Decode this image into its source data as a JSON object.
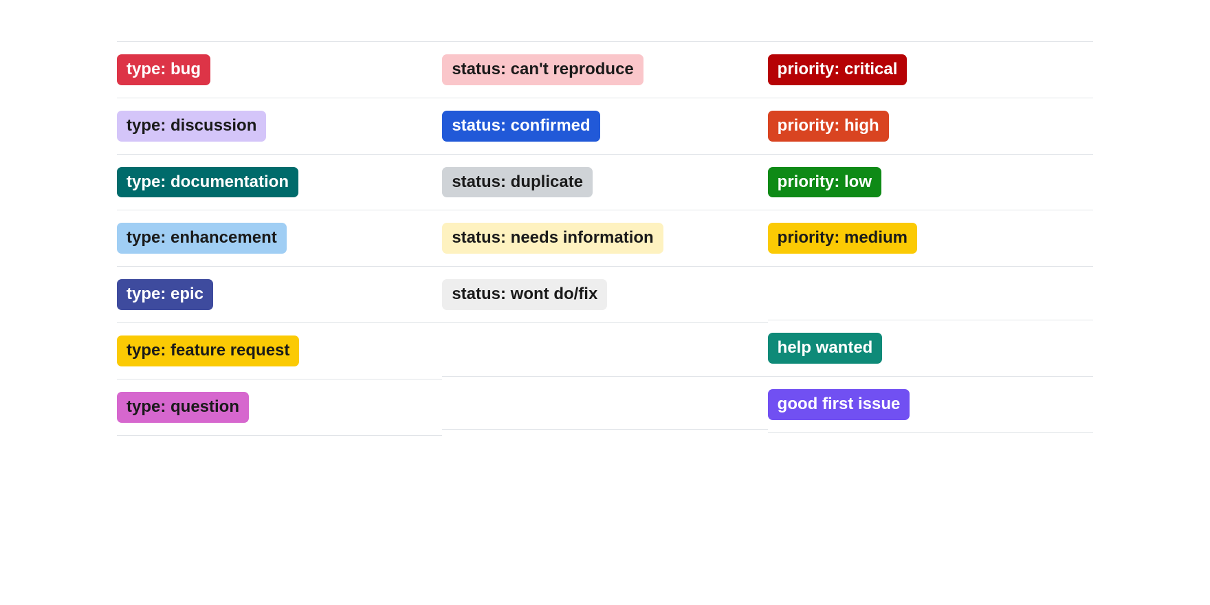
{
  "columns": [
    {
      "name": "type-column",
      "labels": [
        {
          "text": "type: bug",
          "bg": "#dd3447",
          "fg": "#ffffff",
          "slug": "type-bug"
        },
        {
          "text": "type: discussion",
          "bg": "#d4c5f9",
          "fg": "#1a1a1a",
          "slug": "type-discussion"
        },
        {
          "text": "type: documentation",
          "bg": "#006b6b",
          "fg": "#ffffff",
          "slug": "type-documentation"
        },
        {
          "text": "type: enhancement",
          "bg": "#a0cef4",
          "fg": "#1a1a1a",
          "slug": "type-enhancement"
        },
        {
          "text": "type: epic",
          "bg": "#3e4b9e",
          "fg": "#ffffff",
          "slug": "type-epic"
        },
        {
          "text": "type: feature request",
          "bg": "#fbca04",
          "fg": "#1a1a1a",
          "slug": "type-feature-request"
        },
        {
          "text": "type: question",
          "bg": "#d667ce",
          "fg": "#1a1a1a",
          "slug": "type-question"
        }
      ]
    },
    {
      "name": "status-column",
      "labels": [
        {
          "text": "status: can't reproduce",
          "bg": "#fac6ca",
          "fg": "#1a1a1a",
          "slug": "status-cant-reproduce"
        },
        {
          "text": "status: confirmed",
          "bg": "#2159d8",
          "fg": "#ffffff",
          "slug": "status-confirmed"
        },
        {
          "text": "status: duplicate",
          "bg": "#cfd3d7",
          "fg": "#1a1a1a",
          "slug": "status-duplicate"
        },
        {
          "text": "status: needs information",
          "bg": "#fef2c0",
          "fg": "#1a1a1a",
          "slug": "status-needs-information"
        },
        {
          "text": "status: wont do/fix",
          "bg": "#eeeeee",
          "fg": "#1a1a1a",
          "slug": "status-wont-do-fix"
        },
        null,
        null
      ]
    },
    {
      "name": "priority-column",
      "labels": [
        {
          "text": "priority: critical",
          "bg": "#b60205",
          "fg": "#ffffff",
          "slug": "priority-critical"
        },
        {
          "text": "priority: high",
          "bg": "#d94421",
          "fg": "#ffffff",
          "slug": "priority-high"
        },
        {
          "text": "priority: low",
          "bg": "#0e8a16",
          "fg": "#ffffff",
          "slug": "priority-low"
        },
        {
          "text": "priority: medium",
          "bg": "#fbca04",
          "fg": "#1a1a1a",
          "slug": "priority-medium"
        },
        null,
        {
          "text": "help wanted",
          "bg": "#0e8a78",
          "fg": "#ffffff",
          "slug": "help-wanted"
        },
        {
          "text": "good first issue",
          "bg": "#7150f2",
          "fg": "#ffffff",
          "slug": "good-first-issue"
        }
      ]
    }
  ]
}
